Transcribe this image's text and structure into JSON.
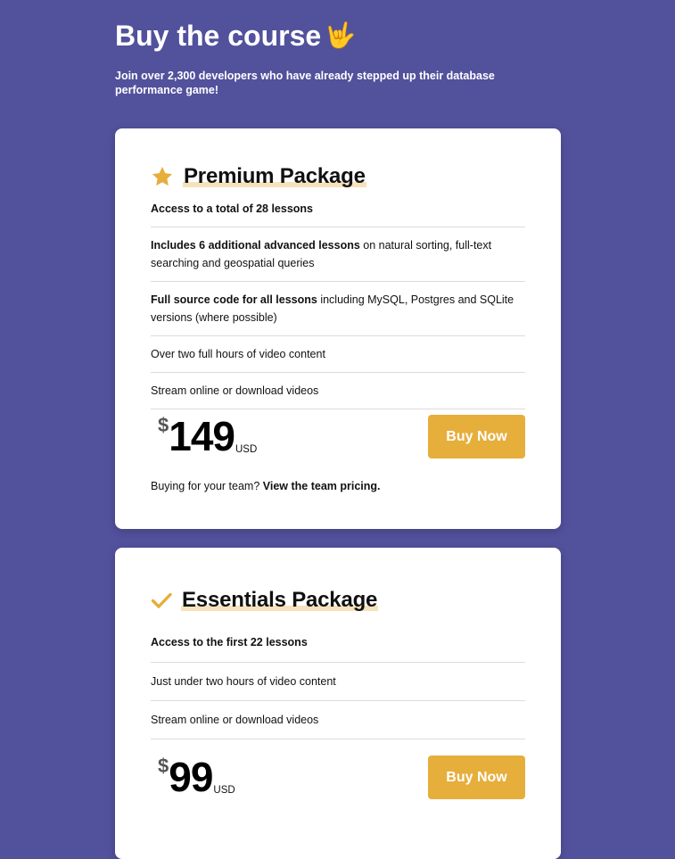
{
  "header": {
    "title": "Buy the course",
    "title_emoji": "🤟",
    "subtitle": "Join over 2,300 developers who have already stepped up their database performance game!"
  },
  "premium": {
    "icon": "star-icon",
    "title": "Premium Package",
    "features": [
      {
        "bold": "Access to a total of 28 lessons",
        "rest": ""
      },
      {
        "bold": "Includes 6 additional advanced lessons",
        "rest": " on natural sorting, full-text searching and geospatial queries"
      },
      {
        "bold": "Full source code for all lessons",
        "rest": " including MySQL, Postgres and SQLite versions (where possible)"
      },
      {
        "bold": "",
        "rest": "Over two full hours of video content"
      },
      {
        "bold": "",
        "rest": "Stream online or download videos"
      }
    ],
    "currency_symbol": "$",
    "price": "149",
    "currency": "USD",
    "buy_label": "Buy Now",
    "team_text": "Buying for your team? ",
    "team_link": "View the team pricing."
  },
  "essentials": {
    "icon": "checkmark-icon",
    "title": "Essentials Package",
    "features": [
      {
        "bold": "Access to the first 22 lessons",
        "rest": ""
      },
      {
        "bold": "",
        "rest": "Just under two hours of video content"
      },
      {
        "bold": "",
        "rest": "Stream online or download videos"
      }
    ],
    "currency_symbol": "$",
    "price": "99",
    "currency": "USD",
    "buy_label": "Buy Now"
  },
  "colors": {
    "background": "#52519c",
    "accent": "#e6ae3b",
    "highlight": "#f6e2bb"
  }
}
